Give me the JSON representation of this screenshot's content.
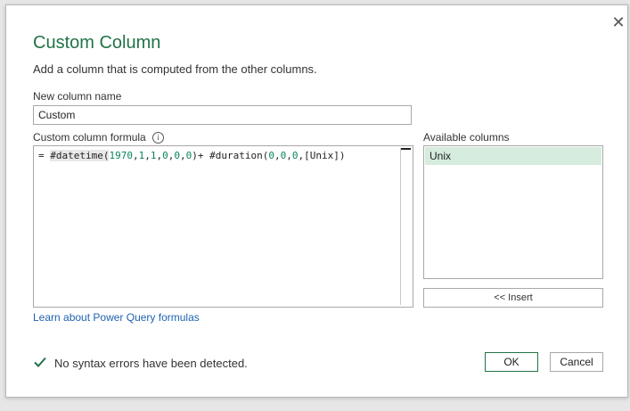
{
  "dialog": {
    "title": "Custom Column",
    "description": "Add a column that is computed from the other columns.",
    "close_glyph": "✕"
  },
  "name_field": {
    "label": "New column name",
    "value": "Custom"
  },
  "formula": {
    "label": "Custom column formula",
    "info_glyph": "i",
    "parts": {
      "prefix": "= ",
      "fn1": "#datetime(",
      "n1970": "1970",
      "c1": ",",
      "n1a": "1",
      "c2": ",",
      "n1b": "1",
      "c3": ",",
      "n0a": "0",
      "c4": ",",
      "n0b": "0",
      "c5": ",",
      "n0c": "0",
      "close1": ")",
      "plus": "+ ",
      "fn2": "#duration(",
      "n0d": "0",
      "c6": ",",
      "n0e": "0",
      "c7": ",",
      "n0f": "0",
      "c8": ",",
      "col": "[Unix]",
      "close2": ")"
    }
  },
  "available_columns": {
    "label": "Available columns",
    "items": [
      "Unix"
    ],
    "insert_label": "<< Insert"
  },
  "learn_link": "Learn about Power Query formulas",
  "status": {
    "text": "No syntax errors have been detected.",
    "icon": "checkmark-icon"
  },
  "buttons": {
    "ok": "OK",
    "cancel": "Cancel"
  },
  "colors": {
    "accent": "#217346",
    "link": "#1e63b0",
    "selection": "#d5ecde"
  }
}
